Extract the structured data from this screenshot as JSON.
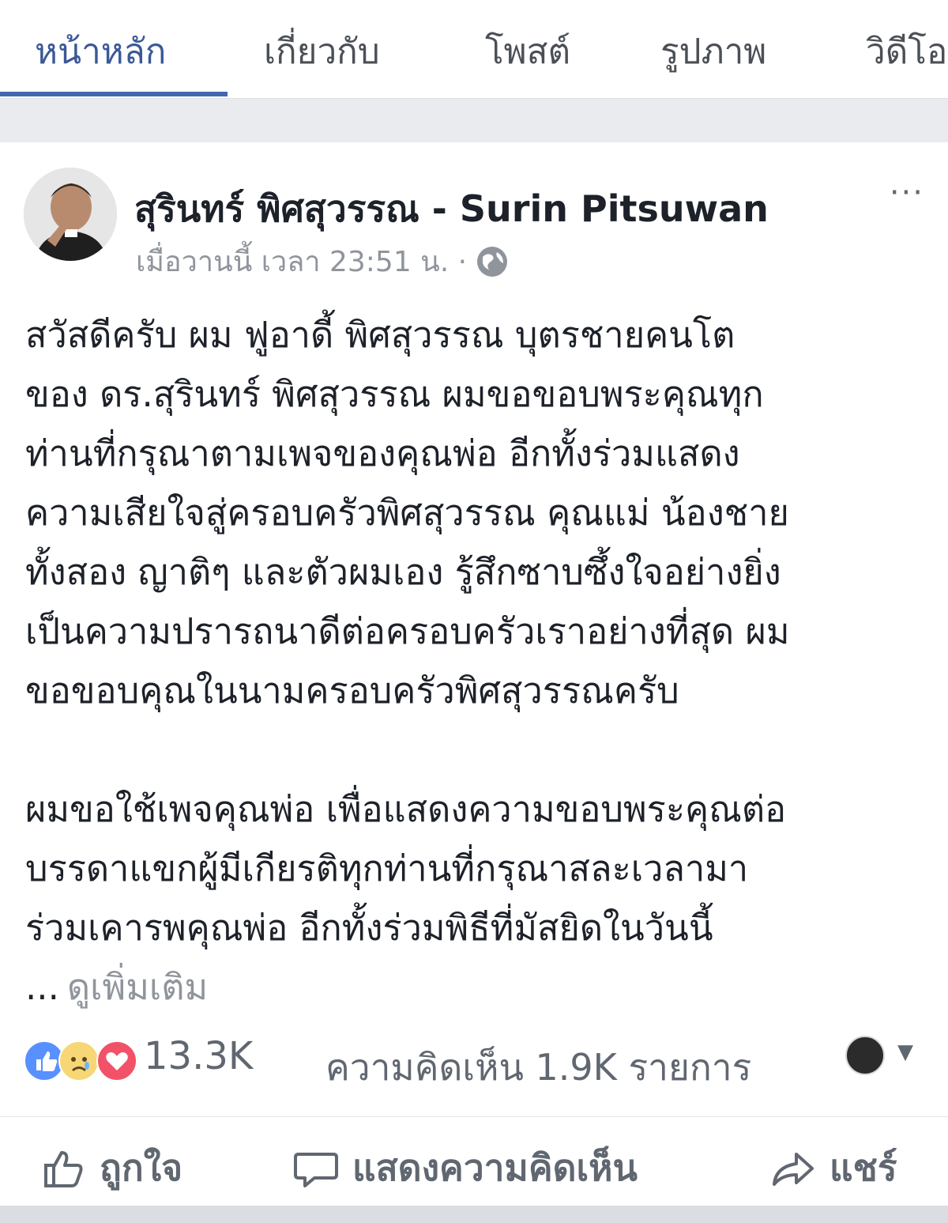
{
  "tabs": [
    {
      "label": "หน้าหลัก",
      "active": true
    },
    {
      "label": "เกี่ยวกับ",
      "active": false
    },
    {
      "label": "โพสต์",
      "active": false
    },
    {
      "label": "รูปภาพ",
      "active": false
    },
    {
      "label": "วิดีโอ",
      "active": false
    }
  ],
  "post": {
    "author": "สุรินทร์ พิศสุวรรณ - Surin Pitsuwan",
    "timestamp": "เมื่อวานนี้ เวลา 23:51 น. ·",
    "more_label": "···",
    "paragraph1": "สวัสดีครับ ผม ฟูอาดี้ พิศสุวรรณ บุตรชายคนโต\nของ ดร.สุรินทร์ พิศสุวรรณ ผมขอขอบพระคุณทุก\nท่านที่กรุณาตามเพจของคุณพ่อ อีกทั้งร่วมแสดง\nความเสียใจสู่ครอบครัวพิศสุวรรณ คุณแม่ น้องชาย\nทั้งสอง ญาติๆ และตัวผมเอง รู้สึกซาบซึ้งใจอย่างยิ่ง\nเป็นความปรารถนาดีต่อครอบครัวเราอย่างที่สุด ผม\nขอขอบคุณในนามครอบครัวพิศสุวรรณครับ",
    "paragraph2": "ผมขอใช้เพจคุณพ่อ เพื่อแสดงความขอบพระคุณต่อ\nบรรดาแขกผู้มีเกียรติทุกท่านที่กรุณาสละเวลามา\nร่วมเคารพคุณพ่อ อีกทั้งร่วมพิธีที่มัสยิดในวันนี้",
    "ellipsis": "...",
    "see_more": "ดูเพิ่มเติม"
  },
  "stats": {
    "reactions_count": "13.3K",
    "comments_text": "ความคิดเห็น 1.9K รายการ",
    "reaction_icons": [
      "like-icon",
      "sad-icon",
      "love-icon"
    ]
  },
  "actions": {
    "like": "ถูกใจ",
    "comment": "แสดงความคิดเห็น",
    "share": "แชร์"
  },
  "colors": {
    "accent": "#3b5998",
    "like": "#5890ff",
    "love": "#f25268",
    "sad": "#f7d775",
    "muted_text": "#90949c"
  }
}
